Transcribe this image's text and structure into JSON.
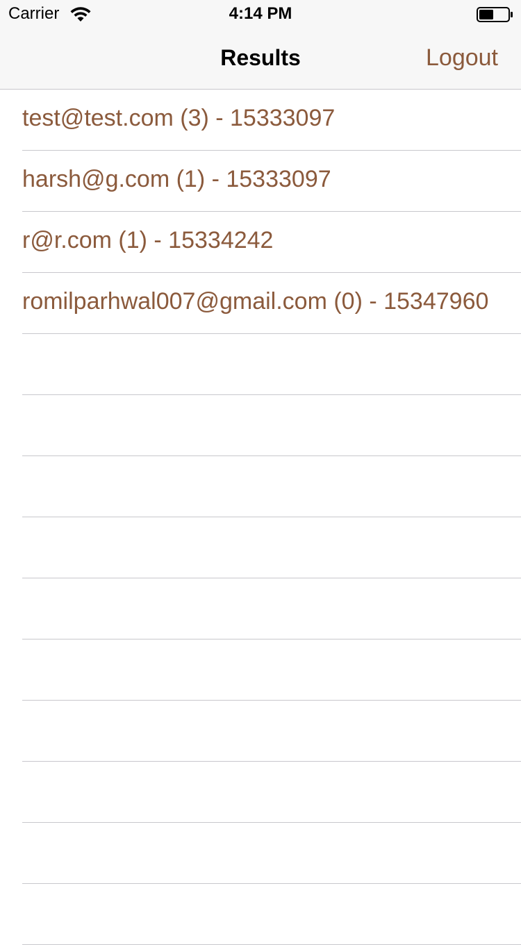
{
  "status_bar": {
    "carrier": "Carrier",
    "time": "4:14 PM",
    "wifi_icon": "wifi-icon",
    "battery_icon": "battery-icon"
  },
  "nav": {
    "title": "Results",
    "logout_label": "Logout"
  },
  "colors": {
    "accent": "#8b5a3c",
    "bar_background": "#f7f7f7",
    "separator": "#c8c7cc"
  },
  "results": [
    "test@test.com (3) - 15333097",
    "harsh@g.com (1) - 15333097",
    "r@r.com (1) - 15334242",
    "romilparhwal007@gmail.com (0) - 15347960"
  ]
}
